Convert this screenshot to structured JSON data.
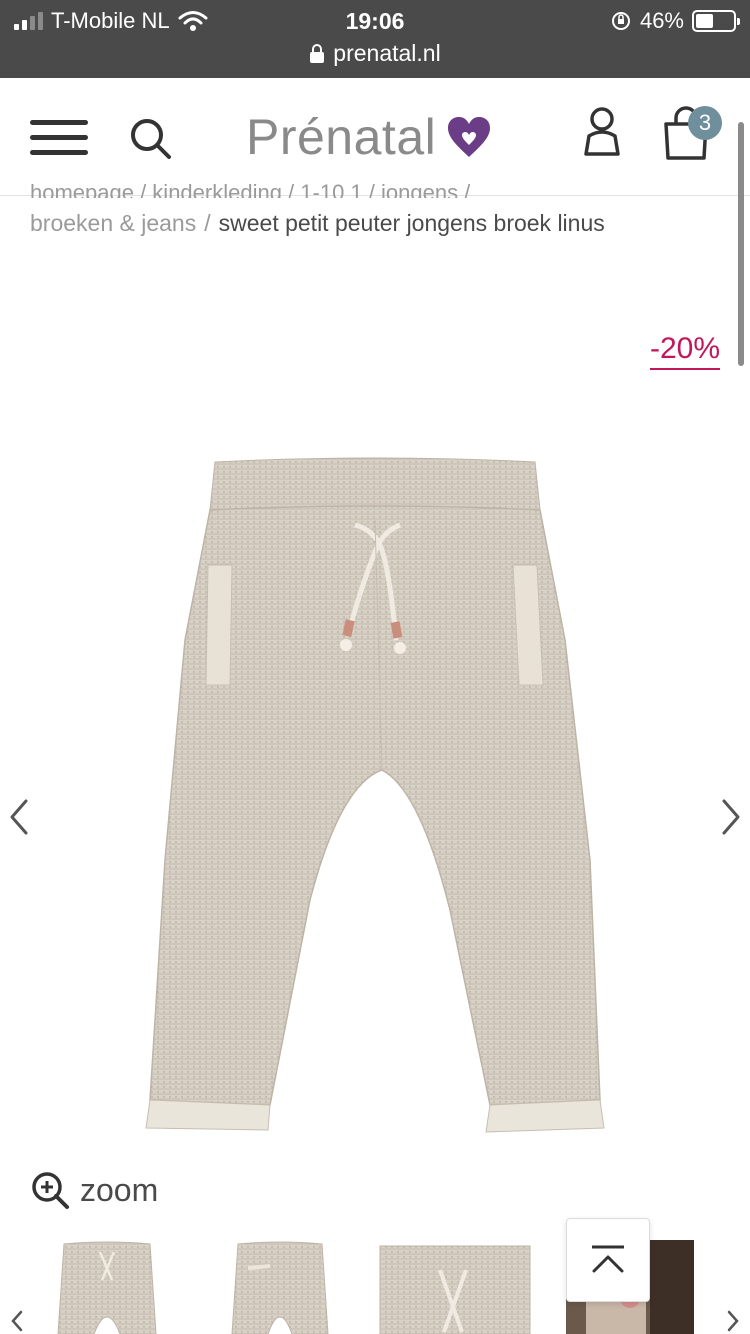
{
  "status_bar": {
    "carrier": "T-Mobile NL",
    "time": "19:06",
    "battery": "46%",
    "battery_level": 0.46,
    "url": "prenatal.nl"
  },
  "header": {
    "logo_text": "Prénatal",
    "cart_count": "3",
    "brand_color": "#6b3d86"
  },
  "breadcrumb": {
    "top_line": "homepage / kinderkleding / 1-10 1 / jongens /",
    "items": [
      "broeken & jeans"
    ],
    "separator": "/",
    "current": "sweet petit peuter jongens broek linus"
  },
  "product": {
    "discount": "-20%",
    "discount_color": "#c2185b",
    "zoom_label": "zoom"
  },
  "icons": {
    "menu": "hamburger-menu-icon",
    "search": "search-icon",
    "account": "user-icon",
    "cart": "shopping-bag-icon",
    "prev": "chevron-left-icon",
    "next": "chevron-right-icon",
    "zoom": "zoom-in-icon",
    "back_to_top": "arrow-up-icon"
  }
}
